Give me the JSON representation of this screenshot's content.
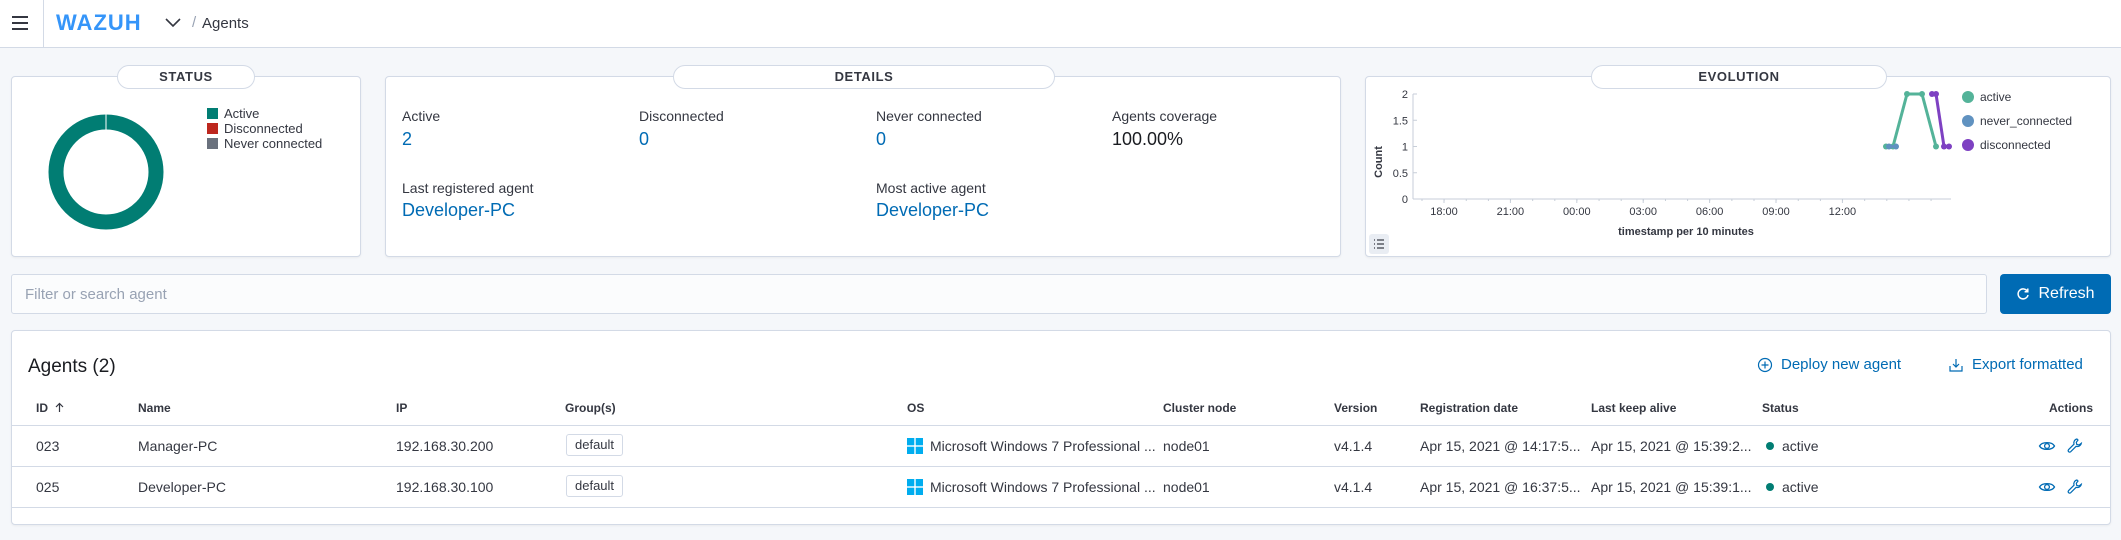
{
  "header": {
    "logo": "WAZUH",
    "breadcrumb_sep": "/",
    "breadcrumb": "Agents"
  },
  "status_panel": {
    "title": "STATUS",
    "legend": [
      {
        "label": "Active",
        "color": "#017D73"
      },
      {
        "label": "Disconnected",
        "color": "#BD271E"
      },
      {
        "label": "Never connected",
        "color": "#6A717D"
      }
    ],
    "active_fraction": 1.0
  },
  "details_panel": {
    "title": "DETAILS",
    "active_label": "Active",
    "active_value": "2",
    "disconnected_label": "Disconnected",
    "disconnected_value": "0",
    "never_label": "Never connected",
    "never_value": "0",
    "coverage_label": "Agents coverage",
    "coverage_value": "100.00%",
    "last_registered_label": "Last registered agent",
    "last_registered_value": "Developer-PC",
    "most_active_label": "Most active agent",
    "most_active_value": "Developer-PC"
  },
  "evolution_panel": {
    "title": "EVOLUTION",
    "chart_data": {
      "type": "line",
      "ylabel": "Count",
      "xlabel": "timestamp per 10 minutes",
      "yticks": [
        "2",
        "1.5",
        "1",
        "0.5",
        "0"
      ],
      "xticks": [
        "18:00",
        "21:00",
        "00:00",
        "03:00",
        "06:00",
        "09:00",
        "12:00"
      ],
      "ylim": [
        0,
        2
      ],
      "series": [
        {
          "name": "active",
          "color": "#54B399",
          "values": [
            1,
            1,
            2,
            2,
            1
          ]
        },
        {
          "name": "never_connected",
          "color": "#6092C0",
          "values": [
            1,
            1
          ]
        },
        {
          "name": "disconnected",
          "color": "#7E41C2",
          "values": [
            2,
            2,
            1,
            1
          ]
        }
      ]
    }
  },
  "search": {
    "placeholder": "Filter or search agent"
  },
  "refresh": {
    "label": "Refresh"
  },
  "table": {
    "title": "Agents (2)",
    "deploy_label": "Deploy new agent",
    "export_label": "Export formatted",
    "columns": {
      "id": "ID",
      "name": "Name",
      "ip": "IP",
      "groups": "Group(s)",
      "os": "OS",
      "cluster": "Cluster node",
      "version": "Version",
      "reg": "Registration date",
      "keep": "Last keep alive",
      "status": "Status",
      "actions": "Actions"
    },
    "rows": [
      {
        "id": "023",
        "name": "Manager-PC",
        "ip": "192.168.30.200",
        "group": "default",
        "os": "Microsoft Windows 7 Professional ...",
        "cluster": "node01",
        "version": "v4.1.4",
        "reg": "Apr 15, 2021 @ 14:17:5...",
        "keep": "Apr 15, 2021 @ 15:39:2...",
        "status": "active"
      },
      {
        "id": "025",
        "name": "Developer-PC",
        "ip": "192.168.30.100",
        "group": "default",
        "os": "Microsoft Windows 7 Professional ...",
        "cluster": "node01",
        "version": "v4.1.4",
        "reg": "Apr 15, 2021 @ 16:37:5...",
        "keep": "Apr 15, 2021 @ 15:39:1...",
        "status": "active"
      }
    ]
  },
  "colors": {
    "link": "#006BB4",
    "active": "#017D73",
    "logo": "#3595F9"
  }
}
